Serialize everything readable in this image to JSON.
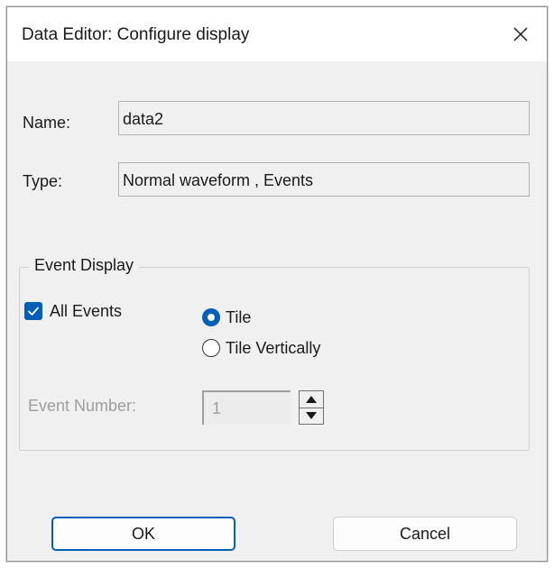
{
  "dialog": {
    "title": "Data Editor: Configure display",
    "name_label": "Name:",
    "name_value": "data2",
    "type_label": "Type:",
    "type_value": "Normal waveform , Events"
  },
  "event_display": {
    "legend": "Event Display",
    "all_events_label": "All Events",
    "all_events_checked": true,
    "options": [
      {
        "label": "Tile",
        "selected": true
      },
      {
        "label": "Tile Vertically",
        "selected": false
      }
    ],
    "event_number_label": "Event Number:",
    "event_number_value": "1"
  },
  "buttons": {
    "ok_label": "OK",
    "cancel_label": "Cancel"
  },
  "colors": {
    "accent": "#005fb8",
    "dialog_bg": "#f0f0f0",
    "disabled_text": "#9e9e9e"
  },
  "icons": {
    "close": "close-icon",
    "checkbox": "checkmark-icon",
    "spin_up": "triangle-up-icon",
    "spin_down": "triangle-down-icon"
  }
}
